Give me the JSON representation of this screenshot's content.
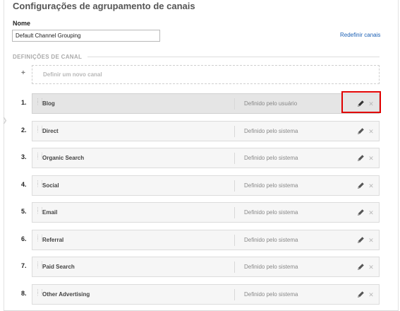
{
  "page": {
    "title": "Configurações de agrupamento de canais"
  },
  "form": {
    "name_label": "Nome",
    "name_value": "Default Channel Grouping",
    "reset_link": "Redefinir canais"
  },
  "definitions": {
    "section_label": "DEFINIÇÕES DE CANAL",
    "add_new_label": "Definir um novo canal",
    "add_icon": "+",
    "channels": [
      {
        "number": "1.",
        "name": "Blog",
        "source": "Definido pelo usuário",
        "highlighted": true
      },
      {
        "number": "2.",
        "name": "Direct",
        "source": "Definido pelo sistema",
        "highlighted": false
      },
      {
        "number": "3.",
        "name": "Organic Search",
        "source": "Definido pelo sistema",
        "highlighted": false
      },
      {
        "number": "4.",
        "name": "Social",
        "source": "Definido pelo sistema",
        "highlighted": false
      },
      {
        "number": "5.",
        "name": "Email",
        "source": "Definido pelo sistema",
        "highlighted": false
      },
      {
        "number": "6.",
        "name": "Referral",
        "source": "Definido pelo sistema",
        "highlighted": false
      },
      {
        "number": "7.",
        "name": "Paid Search",
        "source": "Definido pelo sistema",
        "highlighted": false
      },
      {
        "number": "8.",
        "name": "Other Advertising",
        "source": "Definido pelo sistema",
        "highlighted": false
      }
    ]
  },
  "icons": {
    "edit": "pencil-icon",
    "delete": "close-icon",
    "drag": "drag-handle-icon",
    "side": "chevron-right-icon"
  },
  "colors": {
    "link": "#1a5fb4",
    "highlight": "#e00000",
    "row_background": "#f6f6f6",
    "row_hover_background": "#e5e5e5"
  }
}
